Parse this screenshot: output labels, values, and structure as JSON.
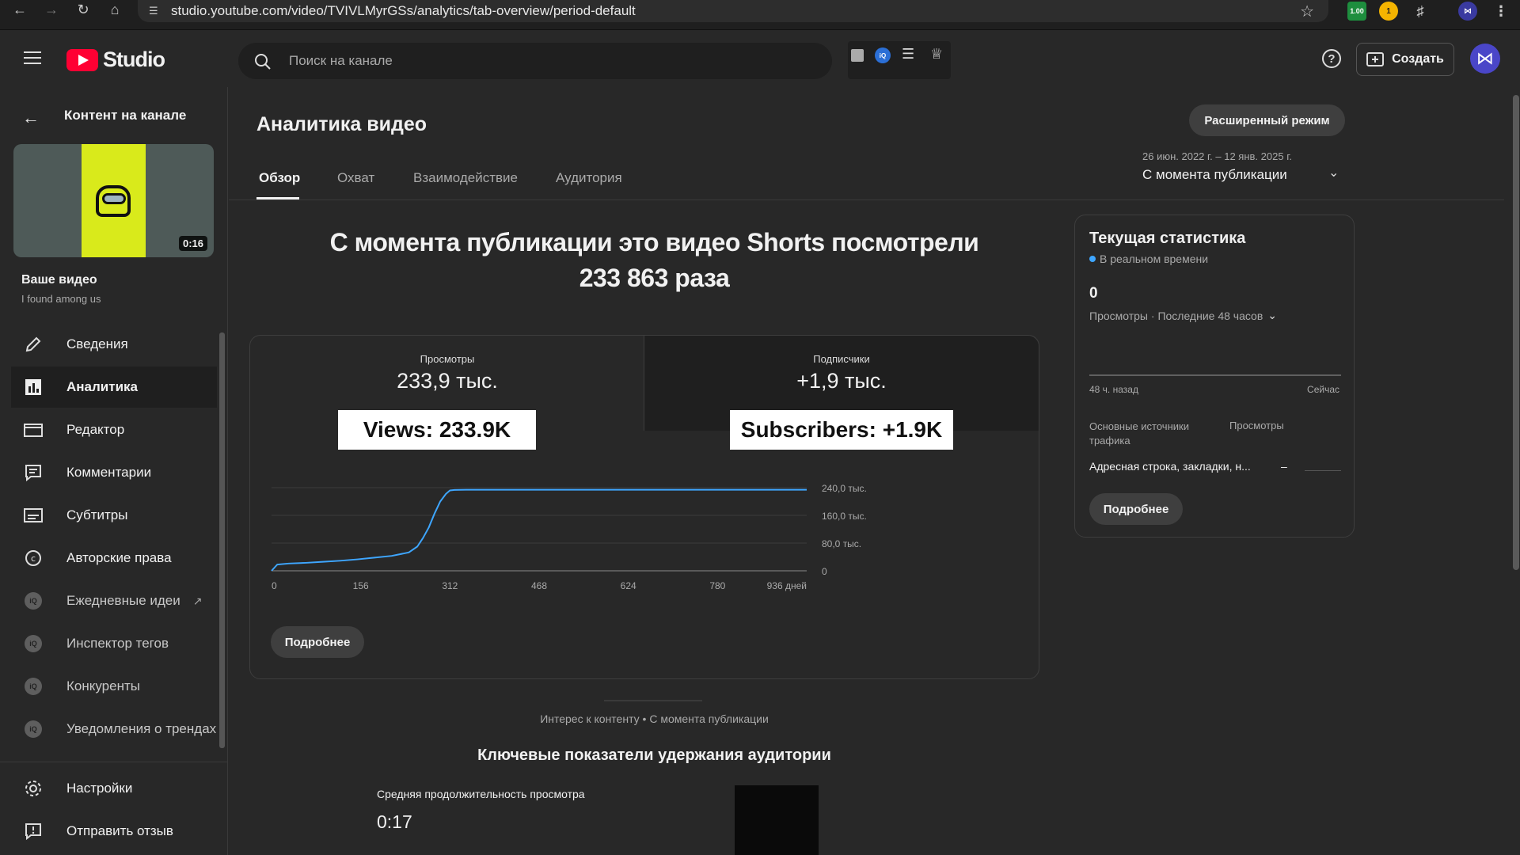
{
  "browser": {
    "url": "studio.youtube.com/video/TVIVLMyrGSs/analytics/tab-overview/period-default",
    "ext_badge_value": "1.00"
  },
  "header": {
    "logo_text": "Studio",
    "search_placeholder": "Поиск на канале",
    "create_label": "Создать"
  },
  "sidebar": {
    "back_label": "Контент на канале",
    "thumb_duration": "0:16",
    "video_heading": "Ваше видео",
    "video_title": "I found among us",
    "items": [
      {
        "label": "Сведения",
        "icon": "pencil-icon"
      },
      {
        "label": "Аналитика",
        "icon": "analytics-icon",
        "active": true
      },
      {
        "label": "Редактор",
        "icon": "film-editor-icon"
      },
      {
        "label": "Комментарии",
        "icon": "comment-icon"
      },
      {
        "label": "Субтитры",
        "icon": "subtitles-icon"
      },
      {
        "label": "Авторские права",
        "icon": "copyright-icon"
      },
      {
        "label": "Ежедневные идеи",
        "icon": "vidiq-icon"
      },
      {
        "label": "Инспектор тегов",
        "icon": "vidiq-icon"
      },
      {
        "label": "Конкуренты",
        "icon": "vidiq-icon"
      },
      {
        "label": "Уведомления о трендах",
        "icon": "vidiq-icon"
      }
    ],
    "settings_label": "Настройки",
    "feedback_label": "Отправить отзыв"
  },
  "main": {
    "page_title": "Аналитика видео",
    "advanced_mode_label": "Расширенный режим",
    "tabs": [
      "Обзор",
      "Охват",
      "Взаимодействие",
      "Аудитория"
    ],
    "period": {
      "range": "26 июн. 2022 г. – 12 янв. 2025 г.",
      "label": "С момента публикации"
    },
    "headline_line1": "С момента публикации это видео Shorts посмотрели",
    "headline_line2": "233 863 раза",
    "metrics": {
      "views_label": "Просмотры",
      "views_value": "233,9 тыс.",
      "subs_label": "Подписчики",
      "subs_value": "+1,9 тыс."
    },
    "overlay_views": "Views: 233.9K",
    "overlay_subs": "Subscribers: +1.9K",
    "more_label": "Подробнее",
    "interest_caption": "Интерес к контенту • С момента публикации",
    "retention_title": "Ключевые показатели удержания аудитории",
    "avg_view_label": "Средняя продолжительность просмотра",
    "avg_view_value": "0:17"
  },
  "realtime": {
    "title": "Текущая статистика",
    "live_label": "В реальном времени",
    "count": "0",
    "views_period": "Просмотры · Последние 48 часов",
    "axis_left": "48 ч. назад",
    "axis_right": "Сейчас",
    "col_sources": "Основные источники трафика",
    "col_views": "Просмотры",
    "source_row": "Адресная строка, закладки, н...",
    "source_value": "–",
    "more_label": "Подробнее"
  },
  "colors": {
    "accent_line": "#3ea6ff",
    "yt_red": "#ff0033",
    "live_dot": "#3ea6ff"
  },
  "chart_data": {
    "type": "line",
    "x_unit": "дней",
    "x_ticks": [
      "0",
      "156",
      "312",
      "468",
      "624",
      "780",
      "936 дней"
    ],
    "y_ticks": [
      "0",
      "80,0 тыс.",
      "160,0 тыс.",
      "240,0 тыс."
    ],
    "xlim": [
      0,
      936
    ],
    "ylim": [
      0,
      240000
    ],
    "series": [
      {
        "x": [
          0,
          10,
          30,
          60,
          90,
          120,
          150,
          180,
          210,
          240,
          255,
          265,
          275,
          285,
          295,
          305,
          312,
          320,
          330,
          340,
          400,
          500,
          600,
          700,
          800,
          900,
          936
        ],
        "y": [
          0,
          18000,
          21000,
          23000,
          26000,
          29000,
          33000,
          38000,
          43000,
          53000,
          70000,
          95000,
          125000,
          165000,
          200000,
          222000,
          232000,
          233500,
          233800,
          233863,
          233863,
          233863,
          233863,
          233863,
          233863,
          233863,
          233863
        ]
      }
    ]
  }
}
